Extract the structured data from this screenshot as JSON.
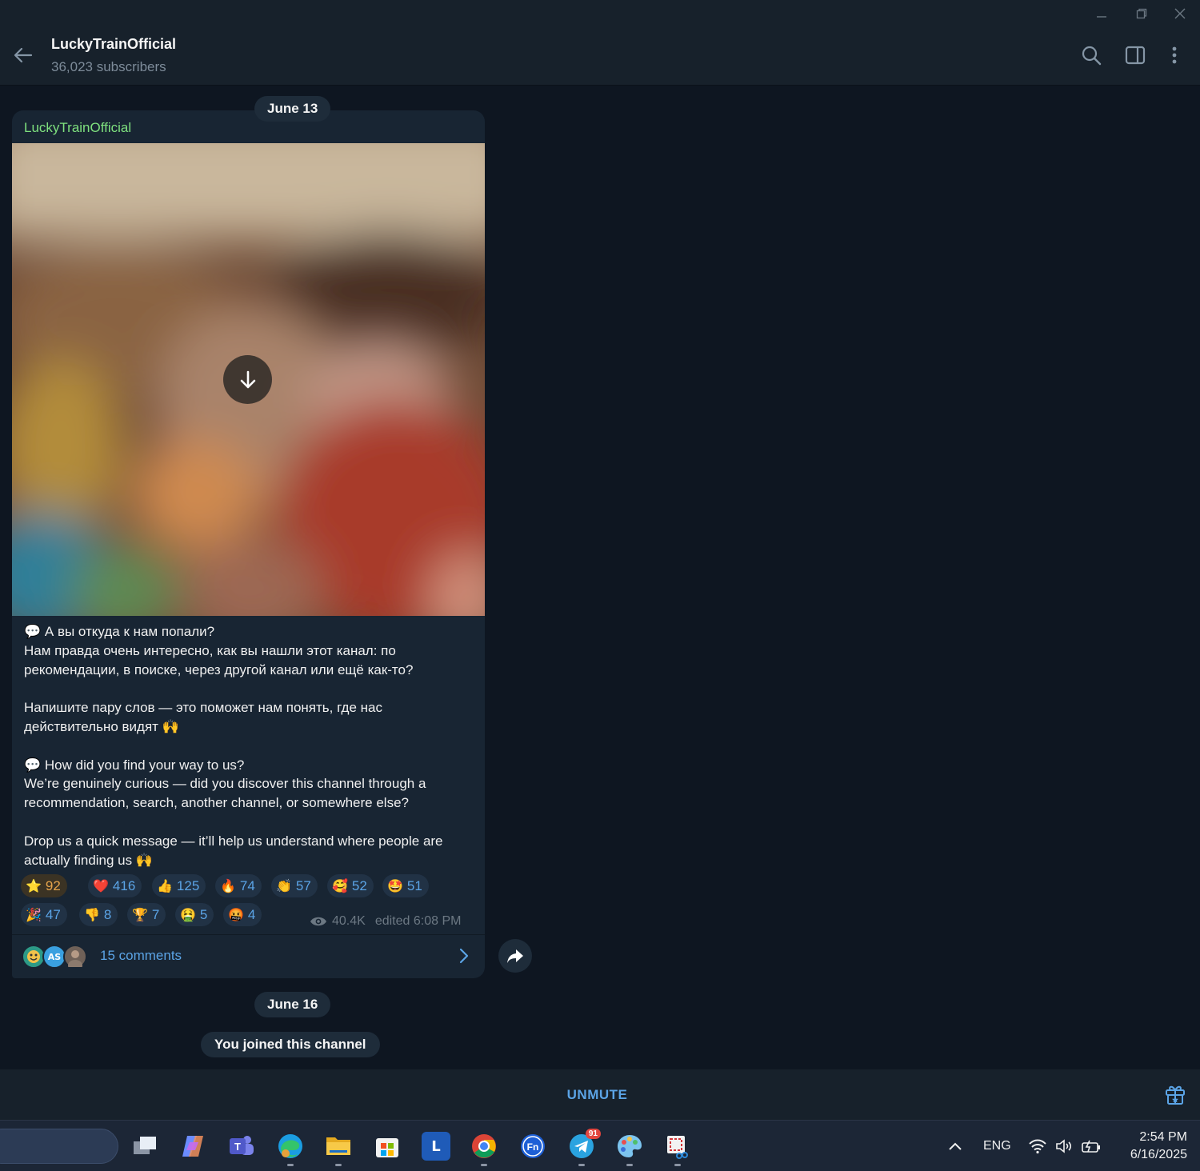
{
  "window": {
    "controls": {
      "minimize_icon": "minimize-icon",
      "restore_icon": "restore-icon",
      "close_icon": "close-icon"
    }
  },
  "header": {
    "title": "LuckyTrainOfficial",
    "subtitle": "36,023 subscribers",
    "icons": [
      "back-arrow-icon",
      "search-icon",
      "sidebar-toggle-icon",
      "more-vertical-icon"
    ]
  },
  "chat": {
    "date_1": "June 13",
    "post": {
      "author": "LuckyTrainOfficial",
      "media": {
        "type": "blurred-image",
        "action_icon": "download-icon"
      },
      "text": {
        "ru_line1": "💬 А вы откуда к нам попали?",
        "ru_line2": "Нам правда очень интересно, как вы нашли этот канал: по рекомендации, в поиске, через другой канал или ещё как-то?",
        "ru_line3": "Напишите пару слов — это поможет нам понять, где нас действительно видят 🙌",
        "en_line1": "💬 How did you find your way to us?",
        "en_line2": "We’re genuinely curious — did you discover this channel through a recommendation, search, another channel, or somewhere else?",
        "en_line3": "Drop us a quick message — it’ll help us understand where people are actually finding us 🙌"
      },
      "reactions": [
        {
          "emoji": "⭐",
          "count": "92"
        },
        {
          "emoji": "❤️",
          "count": "416"
        },
        {
          "emoji": "👍",
          "count": "125"
        },
        {
          "emoji": "🔥",
          "count": "74"
        },
        {
          "emoji": "👏",
          "count": "57"
        },
        {
          "emoji": "🥰",
          "count": "52"
        },
        {
          "emoji": "🤩",
          "count": "51"
        },
        {
          "emoji": "🎉",
          "count": "47"
        },
        {
          "emoji": "👎",
          "count": "8"
        },
        {
          "emoji": "🏆",
          "count": "7"
        },
        {
          "emoji": "🤮",
          "count": "5"
        },
        {
          "emoji": "🤬",
          "count": "4"
        }
      ],
      "views": "40.4K",
      "edited": "edited 6:08 PM",
      "comments": {
        "avatars": [
          "avatar-emoji",
          "AS",
          "avatar-photo"
        ],
        "label": "15 comments"
      }
    },
    "date_2": "June 16",
    "service_message": "You joined this channel"
  },
  "bottom_bar": {
    "unmute_label": "UNMUTE",
    "gift_icon": "gift-icon"
  },
  "taskbar": {
    "apps": [
      {
        "name": "task-view",
        "icon": "task-view-icon"
      },
      {
        "name": "copilot",
        "icon": "copilot-icon"
      },
      {
        "name": "teams",
        "icon": "teams-icon"
      },
      {
        "name": "edge",
        "icon": "edge-icon"
      },
      {
        "name": "file-explorer",
        "icon": "folder-icon"
      },
      {
        "name": "store",
        "icon": "store-icon"
      },
      {
        "name": "l-app",
        "icon": "l-app-icon",
        "label": "L"
      },
      {
        "name": "chrome",
        "icon": "chrome-icon"
      },
      {
        "name": "fn-app",
        "icon": "fn-app-icon",
        "label": "Fn"
      },
      {
        "name": "telegram",
        "icon": "telegram-icon",
        "badge": "91"
      },
      {
        "name": "paint",
        "icon": "paint-icon"
      },
      {
        "name": "snipping",
        "icon": "snipping-icon"
      }
    ],
    "tray": {
      "language": "ENG",
      "time": "2:54 PM",
      "date": "6/16/2025"
    }
  },
  "colors": {
    "background": "#0e1621",
    "panel": "#17212b",
    "bubble": "#182533",
    "accent": "#5ba4e6",
    "author_green": "#7ee07e"
  }
}
